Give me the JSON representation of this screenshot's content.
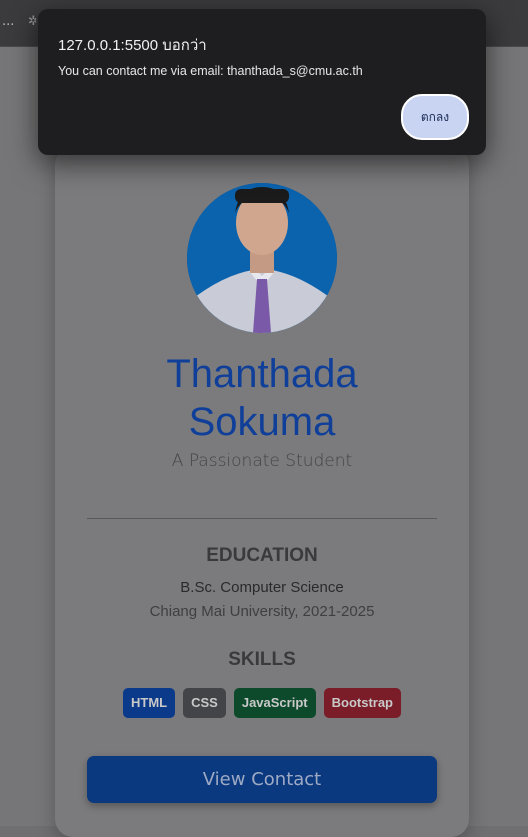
{
  "browser": {
    "dots": "...",
    "extension_glyph": "✲"
  },
  "dialog": {
    "title": "127.0.0.1:5500 บอกว่า",
    "message": "You can contact me via email: thanthada_s@cmu.ac.th",
    "ok_label": "ตกลง"
  },
  "profile": {
    "first_name": "Thanthada",
    "last_name": "Sokuma",
    "tagline": "A Passionate Student"
  },
  "education": {
    "title": "EDUCATION",
    "degree": "B.Sc. Computer Science",
    "school": "Chiang Mai University, 2021-2025"
  },
  "skills": {
    "title": "SKILLS",
    "items": [
      {
        "label": "HTML",
        "color": "#0b3a8a"
      },
      {
        "label": "CSS",
        "color": "#424447"
      },
      {
        "label": "JavaScript",
        "color": "#0d4a2c"
      },
      {
        "label": "Bootstrap",
        "color": "#7a1d28"
      }
    ]
  },
  "cta": {
    "label": "View Contact",
    "color": "#0b3980"
  }
}
